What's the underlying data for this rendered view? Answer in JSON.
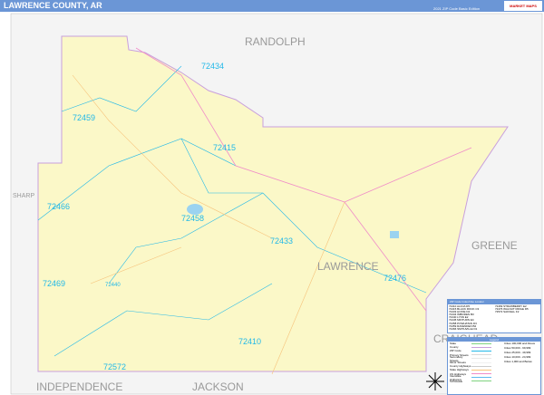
{
  "header": {
    "title": "LAWRENCE COUNTY, AR",
    "edition": "2021 ZIP Code Basic Edition",
    "logo": "MARKET MAPS"
  },
  "counties": {
    "main": "LAWRENCE",
    "neighbors": [
      "RANDOLPH",
      "SHARP",
      "GREENE",
      "CRAIGHEAD",
      "INDEPENDENCE",
      "JACKSON"
    ]
  },
  "zips": [
    "72434",
    "72459",
    "72415",
    "72466",
    "72458",
    "72433",
    "72476",
    "72469",
    "72440",
    "72410",
    "72572"
  ],
  "zip_table": {
    "title": "ZIP Code Index/Use Locator",
    "headers": [
      "ZIP Code",
      "ZIP Name",
      "Grid"
    ],
    "rows": [
      [
        "72410",
        "ALICIA",
        "D5"
      ],
      [
        "72415",
        "BLACK ROCK",
        "C3"
      ],
      [
        "72433",
        "HOXIE",
        "D4"
      ],
      [
        "72434",
        "IMBODEN",
        "B3"
      ],
      [
        "72440",
        "LYNN",
        "E2"
      ],
      [
        "72445",
        "MINTURN",
        "E4"
      ],
      [
        "72458",
        "POWHATAN",
        "D3"
      ],
      [
        "72459",
        "RAVENDEN",
        "B2"
      ],
      [
        "72466",
        "SMITHVILLE",
        "D1"
      ],
      [
        "72469",
        "STRAWBERRY",
        "E2"
      ],
      [
        "72476",
        "WALNUT RIDGE",
        "D5"
      ],
      [
        "72572",
        "SAFFELL",
        "F2"
      ]
    ]
  },
  "legend": {
    "title": "Legend",
    "items": [
      {
        "label": "State",
        "color": "#7fd37f"
      },
      {
        "label": "County",
        "color": "#c9a0dc"
      },
      {
        "label": "ZIP Code",
        "color": "#22b8e8"
      },
      {
        "label": "Primary Streets",
        "color": "#d9d9d9"
      },
      {
        "label": "Secondary Streets",
        "color": "#e8e8e8"
      },
      {
        "label": "Minor Streets",
        "color": "#f0f0f0"
      },
      {
        "label": "County Highways",
        "color": "#cccccc"
      },
      {
        "label": "State Highways",
        "color": "#f7c27a"
      },
      {
        "label": "US Highways",
        "color": "#f08cc8"
      },
      {
        "label": "Interstate Highways",
        "color": "#5fb8f0"
      },
      {
        "label": "Toll Roads",
        "color": "#7fd37f"
      }
    ],
    "city_sizes": [
      "Cities 100,000 and Above",
      "Cities 50,000 - 99,999",
      "Cities 25,000 - 49,999",
      "Cities 10,000 - 24,999",
      "Cities 1,000 and Below"
    ]
  }
}
